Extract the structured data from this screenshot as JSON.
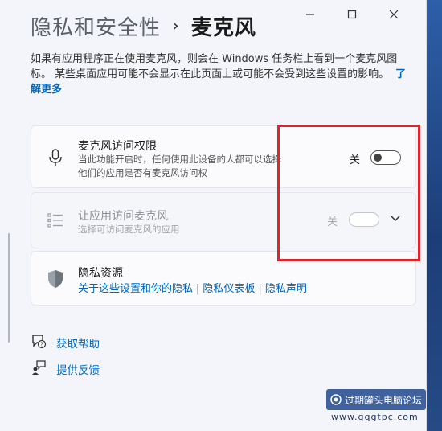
{
  "breadcrumb": {
    "parent": "隐私和安全性",
    "separator": "›",
    "current": "麦克风"
  },
  "description": {
    "text": "如果有应用程序正在使用麦克风，则会在 Windows 任务栏上看到一个麦克风图标。 某些桌面应用可能不会显示在此页面上或可能不会受到这些设置的影响。",
    "learn_more": "了解更多"
  },
  "mic_access": {
    "title": "麦克风访问权限",
    "subtitle": "当此功能开启时，任何使用此设备的人都可以选择他们的应用是否有麦克风访问权",
    "toggle_label": "关",
    "toggle_on": false
  },
  "app_access": {
    "title": "让应用访问麦克风",
    "subtitle": "选择可访问麦克风的应用",
    "toggle_label": "关",
    "toggle_on": false,
    "disabled": true
  },
  "privacy_resources": {
    "title": "隐私资源",
    "links": [
      "关于这些设置和你的隐私",
      "隐私仪表板",
      "隐私声明"
    ]
  },
  "help": {
    "get_help": "获取帮助",
    "feedback": "提供反馈"
  },
  "watermark": {
    "name": "过期罐头电脑论坛",
    "url": "www.gqgtpc.com"
  },
  "colors": {
    "accent": "#0067c0",
    "highlight_box": "#e0242c"
  }
}
